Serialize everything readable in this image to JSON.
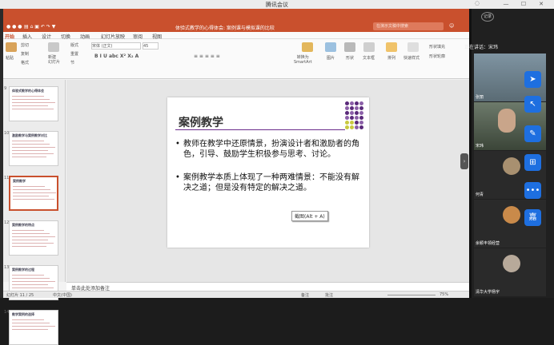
{
  "app": {
    "title": "腾讯会议"
  },
  "ppt": {
    "document_title": "体验式教学的心得体会: 案例课与模拟课的比较",
    "search_placeholder": "在演示文稿中搜索",
    "tabs": [
      "开始",
      "插入",
      "设计",
      "切换",
      "动画",
      "幻灯片放映",
      "审阅",
      "视图"
    ],
    "ribbon": {
      "paste": "粘贴",
      "cut": "剪切",
      "copy": "复制",
      "format": "格式",
      "new_slide": "新建\n幻灯片",
      "layout": "版式",
      "reset": "重置",
      "section": "节",
      "font_name": "宋体 (正文)",
      "font_size": "45",
      "convert_smartart": "转换为\nSmartArt",
      "picture": "图片",
      "shapes": "形状",
      "textbox": "文本框",
      "arrange": "排列",
      "quick_styles": "快速样式",
      "shape_fill": "形状填充",
      "shape_outline": "形状轮廓"
    },
    "thumbnails": [
      {
        "num": "9",
        "heading": "体验式教学的心得体会",
        "lines": 5
      },
      {
        "num": "10",
        "heading": "激励教学与案例教学对比",
        "lines": 6
      },
      {
        "num": "11",
        "heading": "案例教学",
        "lines": 5,
        "selected": true
      },
      {
        "num": "12",
        "heading": "案例教学的特点",
        "lines": 6
      },
      {
        "num": "13",
        "heading": "案例教学的过程",
        "lines": 5
      },
      {
        "num": "14",
        "heading": "教学案例的选择",
        "lines": 4
      }
    ],
    "slide": {
      "title": "案例教学",
      "bullets": [
        "教师在教学中还原情景，扮演设计者和激励者的角色，引导、鼓励学生积极参与思考、讨论。",
        "案例教学本质上体现了一种两难情景：不能没有解决之道；但是没有特定的解决之道。"
      ]
    },
    "tooltip": "截图(Alt + A)",
    "notes_placeholder": "单击此处添加备注",
    "status": {
      "slide_info": "幻灯片 11 / 25",
      "language": "中文(中国)",
      "notes": "备注",
      "comments": "批注",
      "zoom": "75%"
    }
  },
  "meeting": {
    "speaking": "正在讲话：宋玮",
    "participants": [
      {
        "name": "张丽"
      },
      {
        "name": "宋玮"
      },
      {
        "name": "何青"
      },
      {
        "name": "余颖丰领经营"
      },
      {
        "name": "清华大学杨宇"
      }
    ],
    "side_buttons": [
      "",
      "",
      "",
      "",
      ""
    ],
    "side_labels": [
      "",
      "",
      "",
      "",
      ""
    ],
    "top_badge": "记录"
  }
}
